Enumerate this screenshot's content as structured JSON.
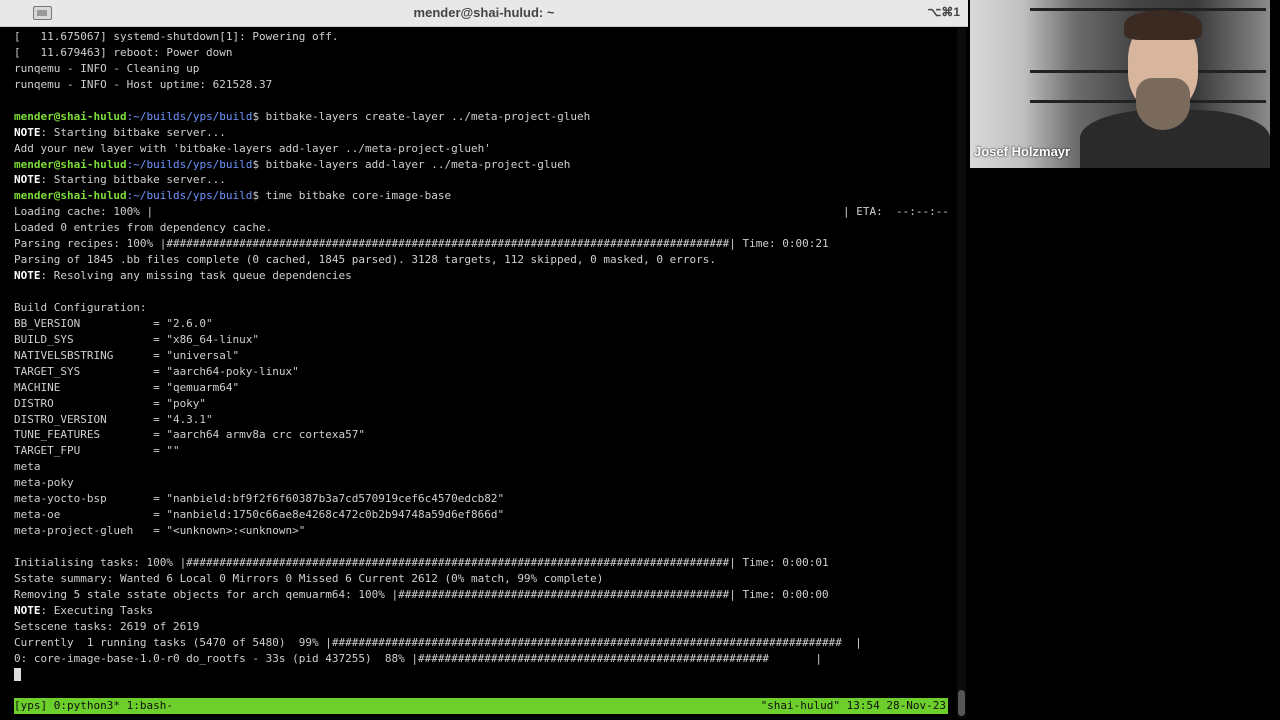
{
  "window": {
    "title": "mender@shai-hulud: ~",
    "shortcut": "⌥⌘1"
  },
  "terminal": {
    "lines": [
      {
        "type": "text",
        "text": "[   11.675067] systemd-shutdown[1]: Powering off."
      },
      {
        "type": "text",
        "text": "[   11.679463] reboot: Power down"
      },
      {
        "type": "text",
        "text": "runqemu - INFO - Cleaning up"
      },
      {
        "type": "text",
        "text": "runqemu - INFO - Host uptime: 621528.37"
      },
      {
        "type": "text",
        "text": ""
      },
      {
        "type": "prompt",
        "user": "mender@shai-hulud",
        "path": ":~/builds/yps/build",
        "cmd": "$ bitbake-layers create-layer ../meta-project-glueh"
      },
      {
        "type": "note",
        "label": "NOTE",
        "text": ": Starting bitbake server..."
      },
      {
        "type": "text",
        "text": "Add your new layer with 'bitbake-layers add-layer ../meta-project-glueh'"
      },
      {
        "type": "prompt",
        "user": "mender@shai-hulud",
        "path": ":~/builds/yps/build",
        "cmd": "$ bitbake-layers add-layer ../meta-project-glueh"
      },
      {
        "type": "note",
        "label": "NOTE",
        "text": ": Starting bitbake server..."
      },
      {
        "type": "prompt",
        "user": "mender@shai-hulud",
        "path": ":~/builds/yps/build",
        "cmd": "$ time bitbake core-image-base"
      },
      {
        "type": "text",
        "text": "Loading cache: 100% |",
        "right": "| ETA:  --:--:--"
      },
      {
        "type": "text",
        "text": "Loaded 0 entries from dependency cache."
      },
      {
        "type": "text",
        "text": "Parsing recipes: 100% |#####################################################################################| Time: 0:00:21"
      },
      {
        "type": "text",
        "text": "Parsing of 1845 .bb files complete (0 cached, 1845 parsed). 3128 targets, 112 skipped, 0 masked, 0 errors."
      },
      {
        "type": "note",
        "label": "NOTE",
        "text": ": Resolving any missing task queue dependencies"
      },
      {
        "type": "text",
        "text": ""
      },
      {
        "type": "text",
        "text": "Build Configuration:"
      },
      {
        "type": "text",
        "text": "BB_VERSION           = \"2.6.0\""
      },
      {
        "type": "text",
        "text": "BUILD_SYS            = \"x86_64-linux\""
      },
      {
        "type": "text",
        "text": "NATIVELSBSTRING      = \"universal\""
      },
      {
        "type": "text",
        "text": "TARGET_SYS           = \"aarch64-poky-linux\""
      },
      {
        "type": "text",
        "text": "MACHINE              = \"qemuarm64\""
      },
      {
        "type": "text",
        "text": "DISTRO               = \"poky\""
      },
      {
        "type": "text",
        "text": "DISTRO_VERSION       = \"4.3.1\""
      },
      {
        "type": "text",
        "text": "TUNE_FEATURES        = \"aarch64 armv8a crc cortexa57\""
      },
      {
        "type": "text",
        "text": "TARGET_FPU           = \"\""
      },
      {
        "type": "text",
        "text": "meta"
      },
      {
        "type": "text",
        "text": "meta-poky"
      },
      {
        "type": "text",
        "text": "meta-yocto-bsp       = \"nanbield:bf9f2f6f60387b3a7cd570919cef6c4570edcb82\""
      },
      {
        "type": "text",
        "text": "meta-oe              = \"nanbield:1750c66ae8e4268c472c0b2b94748a59d6ef866d\""
      },
      {
        "type": "text",
        "text": "meta-project-glueh   = \"<unknown>:<unknown>\""
      },
      {
        "type": "text",
        "text": ""
      },
      {
        "type": "text",
        "text": "Initialising tasks: 100% |##################################################################################| Time: 0:00:01"
      },
      {
        "type": "text",
        "text": "Sstate summary: Wanted 6 Local 0 Mirrors 0 Missed 6 Current 2612 (0% match, 99% complete)"
      },
      {
        "type": "text",
        "text": "Removing 5 stale sstate objects for arch qemuarm64: 100% |##################################################| Time: 0:00:00"
      },
      {
        "type": "note",
        "label": "NOTE",
        "text": ": Executing Tasks"
      },
      {
        "type": "text",
        "text": "Setscene tasks: 2619 of 2619"
      },
      {
        "type": "text",
        "text": "Currently  1 running tasks (5470 of 5480)  99% |#############################################################################  |"
      },
      {
        "type": "text",
        "text": "0: core-image-base-1.0-r0 do_rootfs - 33s (pid 437255)  88% |#####################################################       |"
      },
      {
        "type": "cursor"
      }
    ]
  },
  "statusbar": {
    "left": "[yps] 0:python3* 1:bash-",
    "right": "\"shai-hulud\" 13:54 28-Nov-23"
  },
  "video": {
    "name": "Josef Holzmayr"
  }
}
